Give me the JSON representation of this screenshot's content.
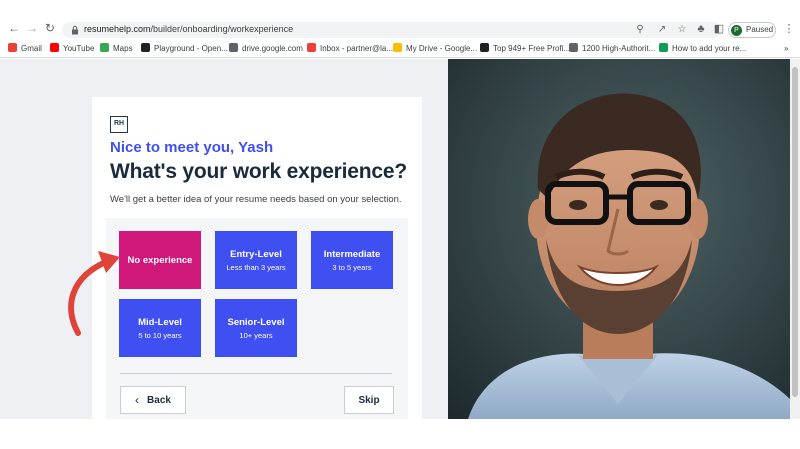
{
  "browser": {
    "url_host": "resumehelp.com",
    "url_path": "/builder/onboarding/workexperience",
    "profile_label": "Paused",
    "profile_initial": "P"
  },
  "bookmarks": [
    {
      "label": "Gmail",
      "icon": "gmail-icon",
      "color": "#ea4335"
    },
    {
      "label": "YouTube",
      "icon": "youtube-icon",
      "color": "#ff0000"
    },
    {
      "label": "Maps",
      "icon": "maps-icon",
      "color": "#34a853"
    },
    {
      "label": "Playground - Open...",
      "icon": "openai-icon",
      "color": "#202124"
    },
    {
      "label": "drive.google.com",
      "icon": "globe-icon",
      "color": "#5f6368"
    },
    {
      "label": "Inbox - partner@la...",
      "icon": "gmail-icon",
      "color": "#ea4335"
    },
    {
      "label": "My Drive - Google...",
      "icon": "drive-icon",
      "color": "#fbbc04"
    },
    {
      "label": "Top 949+ Free Profi...",
      "icon": "site-icon",
      "color": "#202124"
    },
    {
      "label": "1200 High-Authorit...",
      "icon": "globe-icon",
      "color": "#5f6368"
    },
    {
      "label": "How to add your re...",
      "icon": "bolt-icon",
      "color": "#0f9d58"
    }
  ],
  "card": {
    "logo": "RH",
    "greeting": "Nice to meet you, Yash",
    "heading": "What's your work experience?",
    "subtitle": "We'll get a better idea of your resume needs based on your selection.",
    "options": [
      {
        "title": "No experience",
        "sub": "",
        "selected": true
      },
      {
        "title": "Entry-Level",
        "sub": "Less than 3 years",
        "selected": false
      },
      {
        "title": "Intermediate",
        "sub": "3 to 5 years",
        "selected": false
      },
      {
        "title": "Mid-Level",
        "sub": "5 to 10 years",
        "selected": false
      },
      {
        "title": "Senior-Level",
        "sub": "10+ years",
        "selected": false
      }
    ],
    "back_label": "Back",
    "skip_label": "Skip"
  },
  "colors": {
    "accent": "#3f4ff2",
    "selected": "#d0187a",
    "arrow": "#e0433a"
  }
}
